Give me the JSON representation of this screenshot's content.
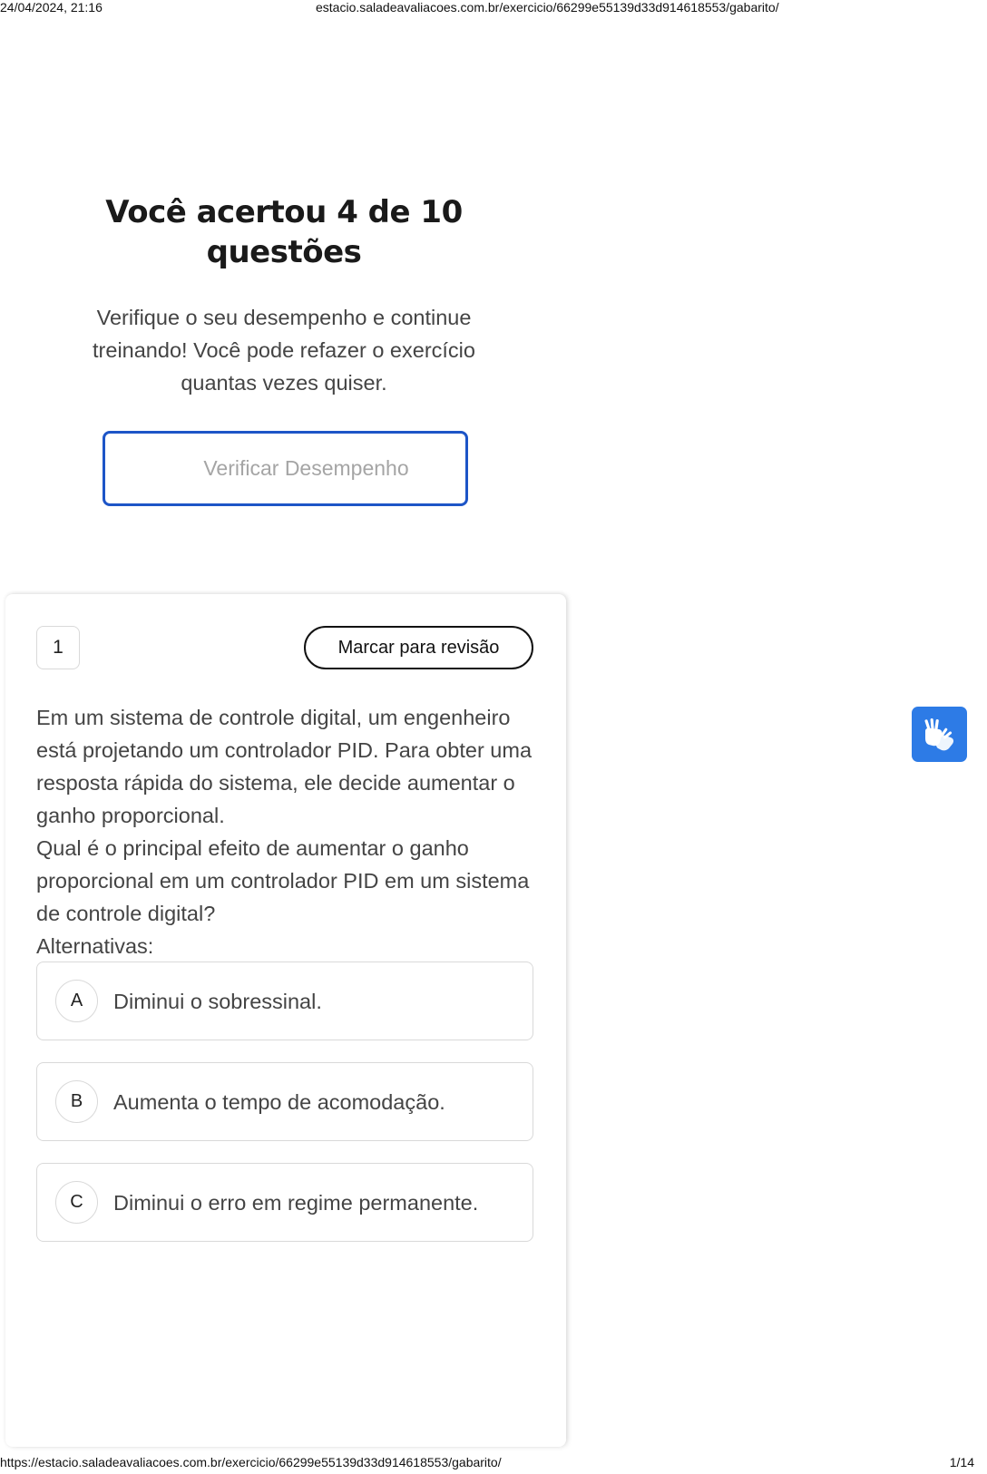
{
  "print_header": {
    "datetime": "24/04/2024, 21:16",
    "url": "estacio.saladeavaliacoes.com.br/exercicio/66299e55139d33d914618553/gabarito/"
  },
  "result": {
    "title": "Você acertou 4 de 10 questões",
    "description": "Verifique o seu desempenho e continue treinando! Você pode refazer o exercício quantas vezes quiser.",
    "verify_button_label": "Verificar Desempenho"
  },
  "question": {
    "number": "1",
    "review_button_label": "Marcar para revisão",
    "paragraphs": [
      "Em um sistema de controle digital, um engenheiro está projetando um controlador PID. Para obter uma resposta rápida do sistema, ele decide aumentar o ganho proporcional.",
      "Qual é o principal efeito de aumentar o ganho proporcional em um controlador PID em um sistema de controle digital?",
      "Alternativas:"
    ],
    "options": [
      {
        "letter": "A",
        "text": "Diminui o sobressinal."
      },
      {
        "letter": "B",
        "text": "Aumenta o tempo de acomodação."
      },
      {
        "letter": "C",
        "text": "Diminui o erro em regime permanente."
      }
    ]
  },
  "accessibility_widget": {
    "icon": "sign-language-hands-icon",
    "color": "#2d7be6"
  },
  "print_footer": {
    "url": "https://estacio.saladeavaliacoes.com.br/exercicio/66299e55139d33d914618553/gabarito/",
    "page": "1/14"
  },
  "colors": {
    "accent": "#1d55c7",
    "muted_text": "#444444",
    "border": "#d9d9d9"
  }
}
